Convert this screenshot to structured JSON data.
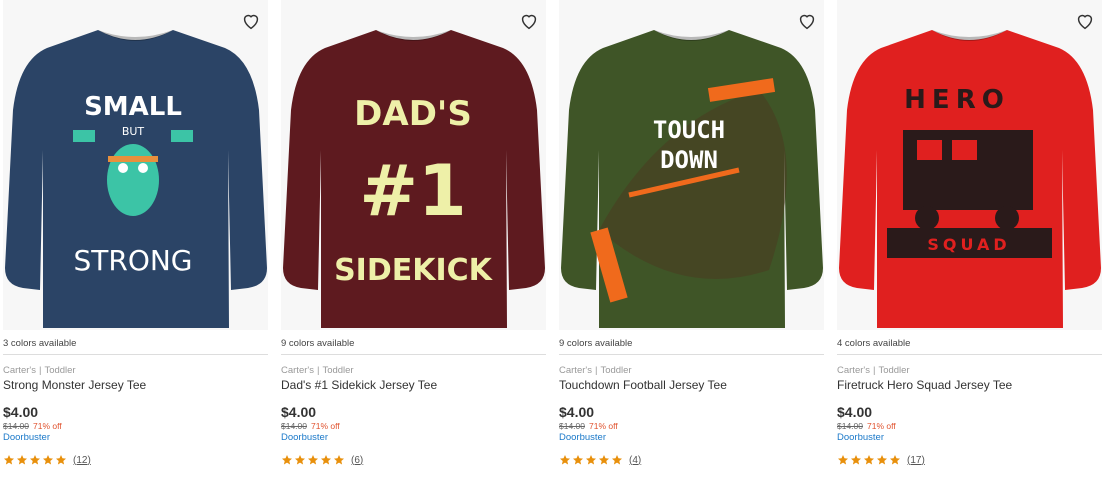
{
  "products": [
    {
      "colors": "3 colors available",
      "brand": "Carter's",
      "segment": "Toddler",
      "name": "Strong Monster Jersey Tee",
      "price": "$4.00",
      "original_price": "$14.00",
      "discount": "71% off",
      "badge": "Doorbuster",
      "review_count": "(12)",
      "rating": 5,
      "shirt_color": "#2b4466",
      "graphic": [
        "SMALL",
        "BUT",
        "STRONG"
      ]
    },
    {
      "colors": "9 colors available",
      "brand": "Carter's",
      "segment": "Toddler",
      "name": "Dad's #1 Sidekick Jersey Tee",
      "price": "$4.00",
      "original_price": "$14.00",
      "discount": "71% off",
      "badge": "Doorbuster",
      "review_count": "(6)",
      "rating": 5,
      "shirt_color": "#5e1a1f",
      "graphic": [
        "DAD'S",
        "#1",
        "SIDEKICK"
      ]
    },
    {
      "colors": "9 colors available",
      "brand": "Carter's",
      "segment": "Toddler",
      "name": "Touchdown Football Jersey Tee",
      "price": "$4.00",
      "original_price": "$14.00",
      "discount": "71% off",
      "badge": "Doorbuster",
      "review_count": "(4)",
      "rating": 5,
      "shirt_color": "#3f5527",
      "graphic": [
        "TOUCH",
        "DOWN"
      ]
    },
    {
      "colors": "4 colors available",
      "brand": "Carter's",
      "segment": "Toddler",
      "name": "Firetruck Hero Squad Jersey Tee",
      "price": "$4.00",
      "original_price": "$14.00",
      "discount": "71% off",
      "badge": "Doorbuster",
      "review_count": "(17)",
      "rating": 5,
      "shirt_color": "#e0201f",
      "graphic": [
        "HERO",
        "SQUAD"
      ]
    }
  ],
  "icons": {
    "favorite": "heart-outline-icon",
    "star": "star-icon"
  },
  "colors": {
    "link": "#1b79c9",
    "discount": "#e0532f",
    "star": "#e8900c"
  }
}
